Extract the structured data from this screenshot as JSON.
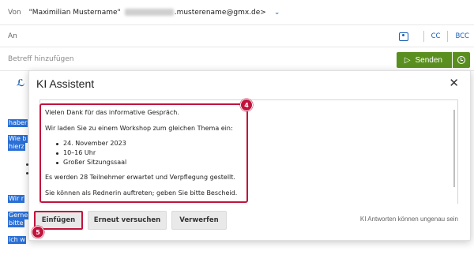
{
  "compose": {
    "from_label": "Von",
    "from_name": "\"Maximilian Mustername\"",
    "from_email_suffix": ".musterename@gmx.de>",
    "to_label": "An",
    "cc_label": "CC",
    "bcc_label": "BCC",
    "subject_placeholder": "Betreff hinzufügen",
    "send_label": "Senden",
    "body_fragments": [
      "haber",
      "Wie b",
      "hierz",
      "Wir r",
      "Gerne",
      "bitte",
      "ich w"
    ]
  },
  "dialog": {
    "title": "KI Assistent",
    "close_label": "✕",
    "text": {
      "line1": "Vielen Dank für das informative Gespräch.",
      "line2": "Wir laden Sie zu einem Workshop zum gleichen Thema ein:",
      "bullets": [
        "24. November 2023",
        "10–16 Uhr",
        "Großer Sitzungssaal"
      ],
      "line3": "Es werden 28 Teilnehmer erwartet und Verpflegung gestellt.",
      "line4": "Sie können als Rednerin auftreten; geben Sie bitte Bescheid."
    },
    "buttons": {
      "insert": "Einfügen",
      "retry": "Erneut versuchen",
      "discard": "Verwerfen"
    },
    "disclaimer": "KI Antworten können ungenau sein"
  },
  "annotations": {
    "badge_text": "4",
    "badge_buttons": "5"
  },
  "colors": {
    "accent_blue": "#1b5fb4",
    "send_green": "#5a8f1f",
    "highlight_red": "#c0143c",
    "selection_blue": "#2a6fd6"
  }
}
